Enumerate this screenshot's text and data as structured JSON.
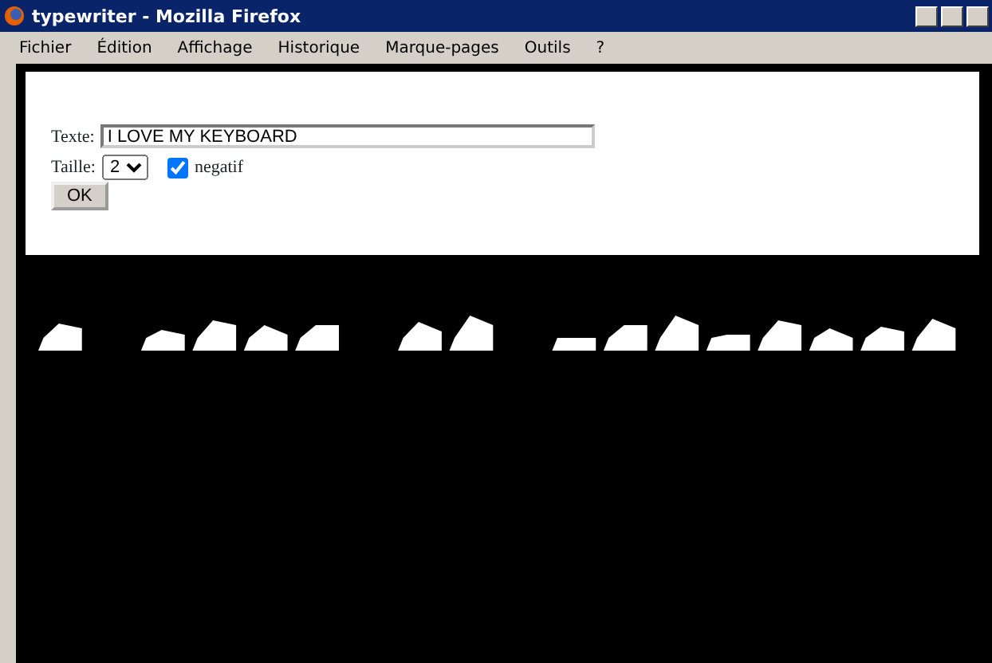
{
  "window": {
    "title": "typewriter - Mozilla Firefox"
  },
  "menu": [
    "Fichier",
    "Édition",
    "Affichage",
    "Historique",
    "Marque-pages",
    "Outils",
    "?"
  ],
  "form": {
    "text_label": "Texte:",
    "text_value": "I LOVE MY KEYBOARD",
    "size_label": "Taille:",
    "size_value": "2",
    "negative_checked": true,
    "negative_label": "negatif",
    "ok_button": "OK"
  }
}
